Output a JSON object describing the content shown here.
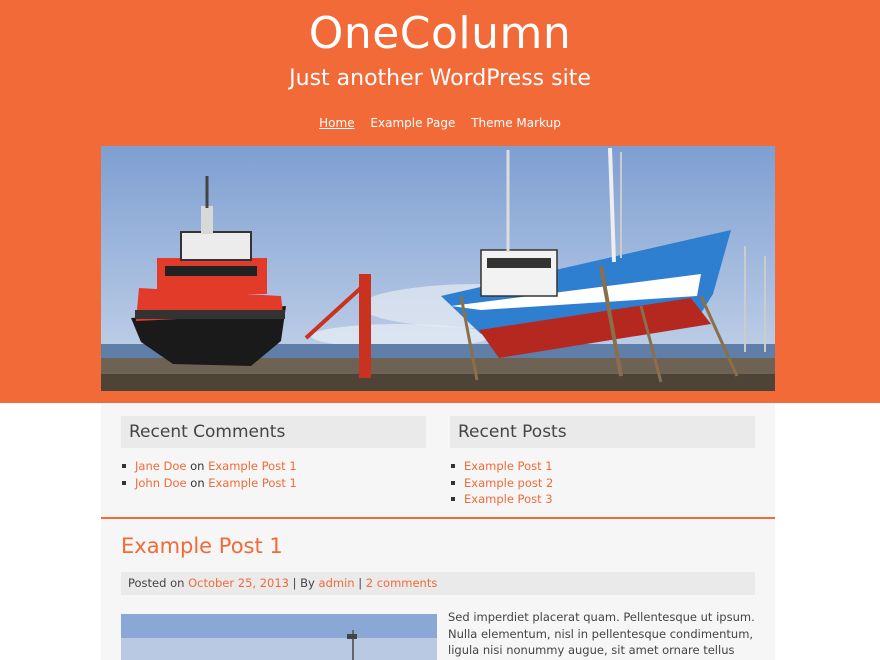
{
  "site": {
    "title": "OneColumn",
    "description": "Just another WordPress site"
  },
  "nav": {
    "items": [
      {
        "label": "Home",
        "current": true
      },
      {
        "label": "Example Page",
        "current": false
      },
      {
        "label": "Theme Markup",
        "current": false
      }
    ]
  },
  "colors": {
    "accent": "#f26a38",
    "content_bg": "#f6f6f6",
    "widget_title_bg": "#eaeaea"
  },
  "widgets": {
    "recent_comments": {
      "title": "Recent Comments",
      "items": [
        {
          "author": "Jane Doe",
          "on": "on",
          "post": "Example Post 1"
        },
        {
          "author": "John Doe",
          "on": "on",
          "post": "Example Post 1"
        }
      ]
    },
    "recent_posts": {
      "title": "Recent Posts",
      "items": [
        "Example Post 1",
        "Example post 2",
        "Example Post 3"
      ]
    }
  },
  "post": {
    "title": "Example Post 1",
    "meta": {
      "posted_on": "Posted on",
      "date": "October 25, 2013",
      "sep1": "| By",
      "author": "admin",
      "sep2": "|",
      "comments": "2 comments"
    },
    "excerpt": "Sed imperdiet placerat quam. Pellentesque ut ipsum. Nulla elementum, nisl in pellentesque condimentum, ligula nisi nonummy augue, sit amet ornare tellus libero"
  }
}
